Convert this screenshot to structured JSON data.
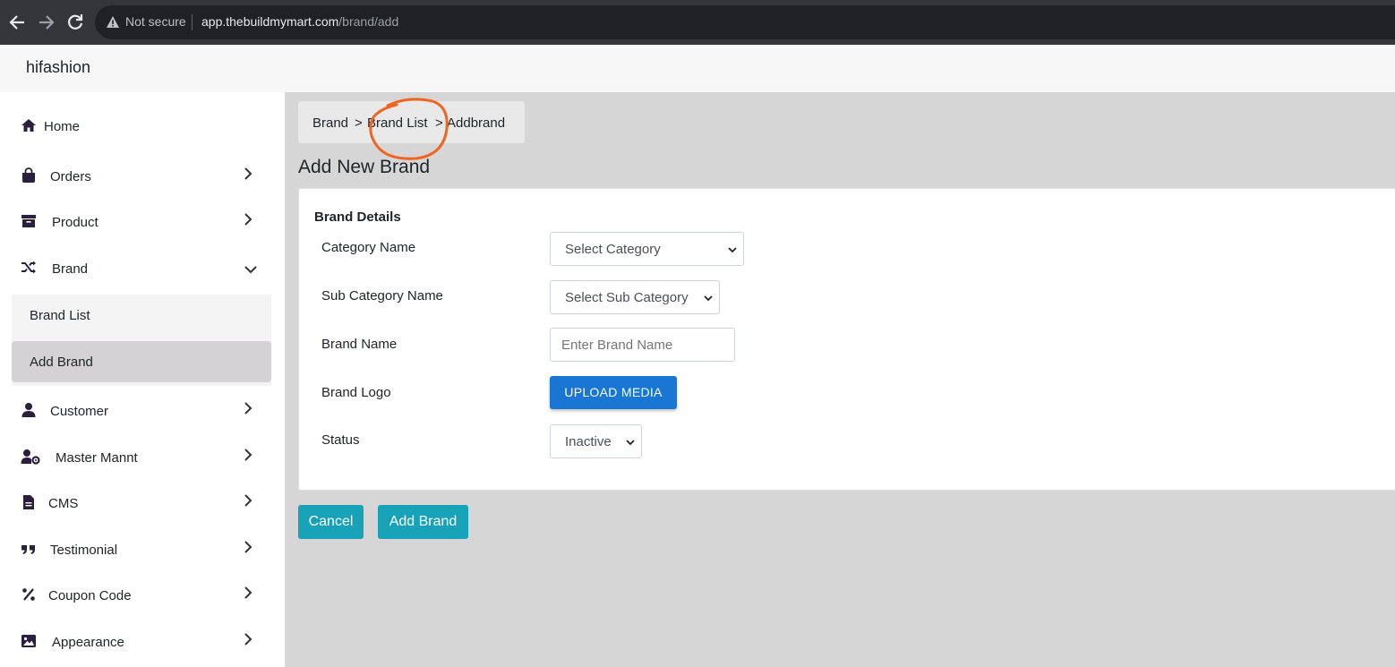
{
  "browser": {
    "security_label": "Not secure",
    "url_host": "app.thebuildmymart.com",
    "url_path": "/brand/add"
  },
  "app": {
    "name": "hifashion"
  },
  "sidebar": {
    "items": [
      {
        "label": "Home",
        "icon": "home-icon"
      },
      {
        "label": "Orders",
        "icon": "shopping-bag-icon"
      },
      {
        "label": "Product",
        "icon": "archive-icon"
      },
      {
        "label": "Brand",
        "icon": "shuffle-icon"
      },
      {
        "label": "Customer",
        "icon": "user-icon"
      },
      {
        "label": "Master Mannt",
        "icon": "user-cog-icon"
      },
      {
        "label": "CMS",
        "icon": "file-icon"
      },
      {
        "label": "Testimonial",
        "icon": "quote-icon"
      },
      {
        "label": "Coupon Code",
        "icon": "percent-icon"
      },
      {
        "label": "Appearance",
        "icon": "image-icon"
      }
    ],
    "brand_sub": [
      {
        "label": "Brand List"
      },
      {
        "label": "Add Brand"
      }
    ]
  },
  "breadcrumb": {
    "items": [
      "Brand",
      "Brand List",
      "Addbrand"
    ],
    "separator": ">"
  },
  "page": {
    "title": "Add New Brand"
  },
  "form": {
    "section_title": "Brand Details",
    "category": {
      "label": "Category Name",
      "value": "Select Category"
    },
    "sub_category": {
      "label": "Sub Category Name",
      "value": "Select Sub Category"
    },
    "brand_name": {
      "label": "Brand Name",
      "placeholder": "Enter Brand Name"
    },
    "brand_logo": {
      "label": "Brand Logo",
      "button": "UPLOAD MEDIA"
    },
    "status": {
      "label": "Status",
      "value": "Inactive"
    }
  },
  "actions": {
    "cancel": "Cancel",
    "submit": "Add Brand"
  },
  "colors": {
    "primary_button": "#17a2b8",
    "upload_button": "#1976d2",
    "annotation": "#f0651f"
  }
}
